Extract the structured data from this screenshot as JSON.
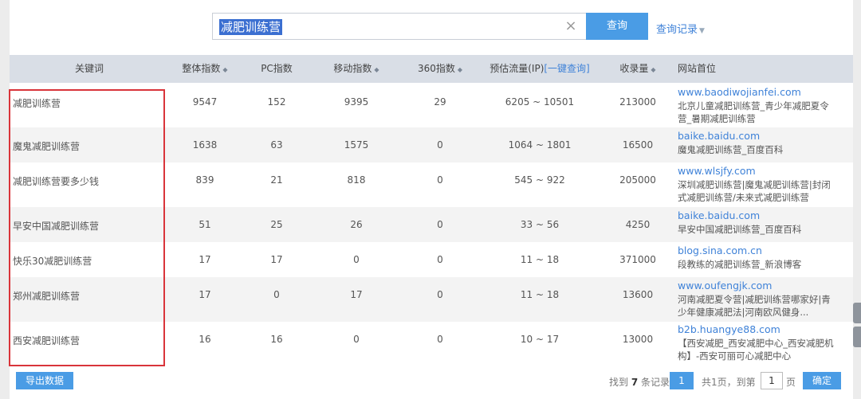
{
  "search": {
    "query": "减肥训练营",
    "clear_icon": "×",
    "button_label": "查询",
    "history_label": "查询记录"
  },
  "table": {
    "headers": {
      "keyword": "关键词",
      "overall": "整体指数",
      "pc": "PC指数",
      "mobile": "移动指数",
      "i360": "360指数",
      "traffic": "预估流量(IP)",
      "traffic_link": "[一键查询]",
      "indexed": "收录量",
      "site": "网站首位"
    },
    "rows": [
      {
        "keyword": "减肥训练营",
        "overall": "9547",
        "pc": "152",
        "mobile": "9395",
        "i360": "29",
        "traffic": "6205 ~ 10501",
        "indexed": "213000",
        "site_url": "www.baodiwojianfei.com",
        "site_title": "北京儿童减肥训练营_青少年减肥夏令营_暑期减肥训练营"
      },
      {
        "keyword": "魔鬼减肥训练营",
        "overall": "1638",
        "pc": "63",
        "mobile": "1575",
        "i360": "0",
        "traffic": "1064 ~ 1801",
        "indexed": "16500",
        "site_url": "baike.baidu.com",
        "site_title": "魔鬼减肥训练营_百度百科"
      },
      {
        "keyword": "减肥训练营要多少钱",
        "overall": "839",
        "pc": "21",
        "mobile": "818",
        "i360": "0",
        "traffic": "545 ~ 922",
        "indexed": "205000",
        "site_url": "www.wlsjfy.com",
        "site_title": "深圳减肥训练营|魔鬼减肥训练营|封闭式减肥训练营/未来式减肥训练营"
      },
      {
        "keyword": "早安中国减肥训练营",
        "overall": "51",
        "pc": "25",
        "mobile": "26",
        "i360": "0",
        "traffic": "33 ~ 56",
        "indexed": "4250",
        "site_url": "baike.baidu.com",
        "site_title": "早安中国减肥训练营_百度百科"
      },
      {
        "keyword": "快乐30减肥训练营",
        "overall": "17",
        "pc": "17",
        "mobile": "0",
        "i360": "0",
        "traffic": "11 ~ 18",
        "indexed": "371000",
        "site_url": "blog.sina.com.cn",
        "site_title": "段教练的减肥训练营_新浪博客"
      },
      {
        "keyword": "郑州减肥训练营",
        "overall": "17",
        "pc": "0",
        "mobile": "17",
        "i360": "0",
        "traffic": "11 ~ 18",
        "indexed": "13600",
        "site_url": "www.oufengjk.com",
        "site_title": "河南减肥夏令营|减肥训练营哪家好|青少年健康减肥法|河南欧风健身..."
      },
      {
        "keyword": "西安减肥训练营",
        "overall": "16",
        "pc": "16",
        "mobile": "0",
        "i360": "0",
        "traffic": "10 ~ 17",
        "indexed": "13000",
        "site_url": "b2b.huangye88.com",
        "site_title": "【西安减肥_西安减肥中心_西安减肥机构】-西安可丽可心减肥中心"
      }
    ]
  },
  "footer": {
    "export_label": "导出数据",
    "found_prefix": "找到",
    "found_count": "7",
    "found_suffix": "条记录",
    "current_page": "1",
    "total_pages_text": "共1页，到第",
    "goto_value": "1",
    "page_suffix": "页",
    "confirm_label": "确定"
  },
  "colors": {
    "accent": "#4a9ce5",
    "link": "#3f82d8",
    "header_bg": "#d9dee6",
    "highlight_box": "#d9343a"
  }
}
